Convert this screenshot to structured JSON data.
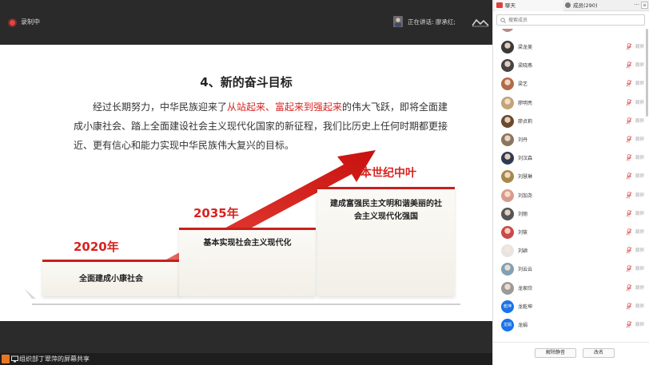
{
  "topbar": {
    "recording": "录制中",
    "speaking": "正在讲话: 廖承红;"
  },
  "slide": {
    "title": "4、新的奋斗目标",
    "para": {
      "p1": "经过长期努力，中华民族迎来了",
      "highlight": "从站起来、富起来到强起来",
      "p2": "的伟大飞跃，即将全面建成小康社会、踏上全面建设社会主义现代化国家的新征程，我们比历史上任何时期都更接近、更有信心和能力实现中华民族伟大复兴的目标。"
    },
    "steps": [
      {
        "year": "2020年",
        "label": "全面建成小康社会"
      },
      {
        "year": "2035年",
        "label": "基本实现社会主义现代化"
      },
      {
        "year": "本世纪中叶",
        "label": "建成富强民主文明和谐美丽的社会主义现代化强国"
      }
    ],
    "accent_color": "#d8231f"
  },
  "status_bar": {
    "share_text": "组织部丁翠萍的屏幕共享"
  },
  "panel": {
    "tabs": {
      "chat": "聊天",
      "members": "成员(290)",
      "more": "···"
    },
    "search_placeholder": "搜索成员",
    "members": [
      {
        "name": "梁龙美",
        "status": "翻屏",
        "avatar": "#3a3a3a"
      },
      {
        "name": "梁晓燕",
        "status": "翻屏",
        "avatar": "#444"
      },
      {
        "name": "梁艺",
        "status": "翻屏",
        "avatar": "#b06b4a"
      },
      {
        "name": "廖明亮",
        "status": "翻屏",
        "avatar": "#c2a37a"
      },
      {
        "name": "廖贞莉",
        "status": "翻屏",
        "avatar": "#6a4a2f"
      },
      {
        "name": "刘丹",
        "status": "翻屏",
        "avatar": "#8a7560"
      },
      {
        "name": "刘汉森",
        "status": "翻屏",
        "avatar": "#2f3b52"
      },
      {
        "name": "刘慧琳",
        "status": "翻屏",
        "avatar": "#a8884a"
      },
      {
        "name": "刘加尧",
        "status": "翻屏",
        "avatar": "#d79b8d"
      },
      {
        "name": "刘丽",
        "status": "翻屏",
        "avatar": "#555"
      },
      {
        "name": "刘筱",
        "status": "翻屏",
        "avatar": "#c94a4a"
      },
      {
        "name": "刘颖",
        "status": "翻屏",
        "avatar": "#e5e5e5"
      },
      {
        "name": "刘云云",
        "status": "翻屏",
        "avatar": "#7fa0b5"
      },
      {
        "name": "龙家欣",
        "status": "翻屏",
        "avatar": "#9a9a9a"
      },
      {
        "name": "龙乾坤",
        "status": "翻屏",
        "avatar": "#1a73e8",
        "initials": "乾坤"
      },
      {
        "name": "龙娟",
        "status": "翻屏",
        "avatar": "#1a73e8",
        "initials": "龙娟"
      }
    ],
    "footer": {
      "unmute_all": "解除静音",
      "rename": "改名"
    }
  }
}
